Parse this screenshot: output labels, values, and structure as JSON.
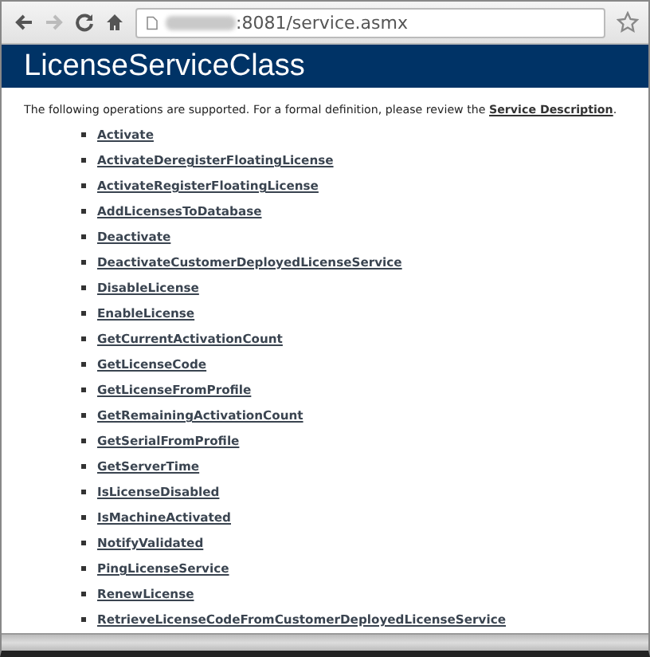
{
  "browser": {
    "url": ":8081/service.asmx"
  },
  "header": {
    "title": "LicenseServiceClass"
  },
  "intro": {
    "text": "The following operations are supported. For a formal definition, please review the ",
    "link": "Service Description",
    "end": "."
  },
  "operations": [
    "Activate",
    "ActivateDeregisterFloatingLicense",
    "ActivateRegisterFloatingLicense",
    "AddLicensesToDatabase",
    "Deactivate",
    "DeactivateCustomerDeployedLicenseService",
    "DisableLicense",
    "EnableLicense",
    "GetCurrentActivationCount",
    "GetLicenseCode",
    "GetLicenseFromProfile",
    "GetRemainingActivationCount",
    "GetSerialFromProfile",
    "GetServerTime",
    "IsLicenseDisabled",
    "IsMachineActivated",
    "NotifyValidated",
    "PingLicenseService",
    "RenewLicense",
    "RetrieveLicenseCodeFromCustomerDeployedLicenseService"
  ]
}
